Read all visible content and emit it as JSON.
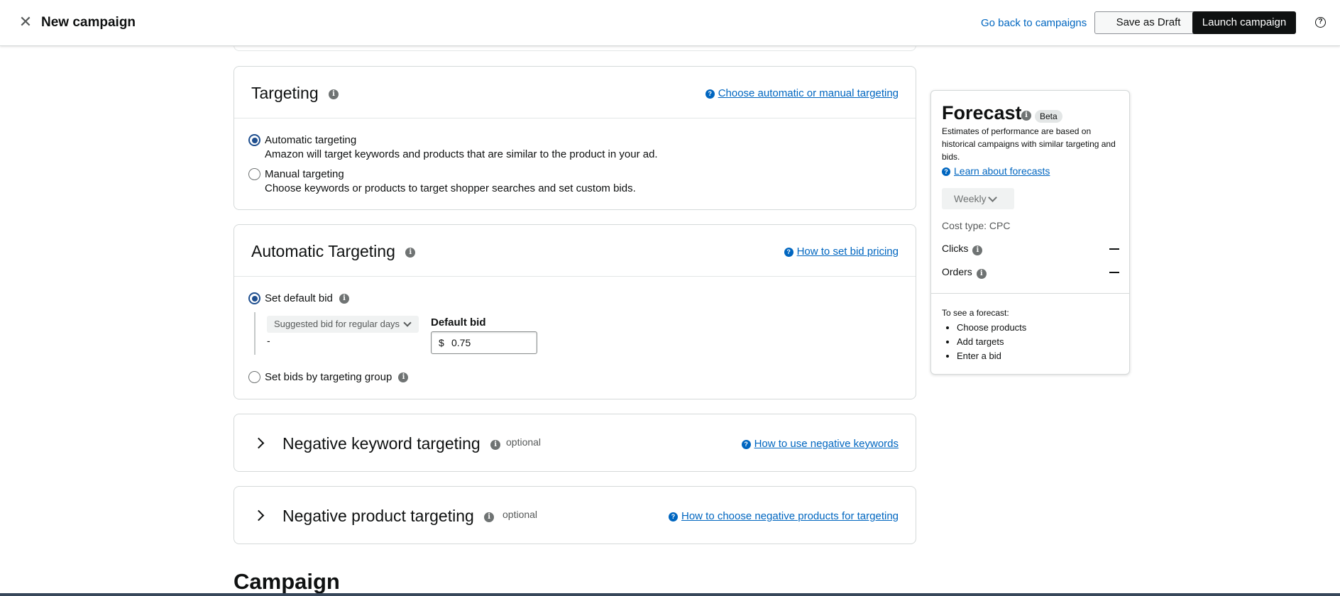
{
  "header": {
    "title": "New campaign",
    "back_link": "Go back to campaigns",
    "save_draft": "Save as Draft",
    "launch": "Launch campaign",
    "help": "?"
  },
  "targeting": {
    "title": "Targeting",
    "help_link": "Choose automatic or manual targeting",
    "options": [
      {
        "label": "Automatic targeting",
        "description": "Amazon will target keywords and products that are similar to the product in your ad.",
        "selected": true
      },
      {
        "label": "Manual targeting",
        "description": "Choose keywords or products to target shopper searches and set custom bids.",
        "selected": false
      }
    ]
  },
  "automatic_targeting": {
    "title": "Automatic Targeting",
    "help_link": "How to set bid pricing",
    "default_bid_option": "Set default bid",
    "suggested_bid_select": "Suggested bid for regular days",
    "suggested_bid_value": "-",
    "default_bid_label": "Default bid",
    "currency": "$",
    "default_bid_value": "0.75",
    "group_option": "Set bids by targeting group"
  },
  "negative_keyword": {
    "title": "Negative keyword targeting",
    "optional": "optional",
    "help_link": "How to use negative keywords"
  },
  "negative_product": {
    "title": "Negative product targeting",
    "optional": "optional",
    "help_link": "How to choose negative products for targeting"
  },
  "campaign_heading": "Campaign",
  "forecast": {
    "title": "Forecast",
    "badge": "Beta",
    "description": "Estimates of performance are based on historical campaigns with similar targeting and bids.",
    "learn_link": "Learn about forecasts",
    "period": "Weekly",
    "cost_type": "Cost type: CPC",
    "metrics": [
      {
        "label": "Clicks"
      },
      {
        "label": "Orders"
      }
    ],
    "note": "To see a forecast:",
    "steps": [
      "Choose products",
      "Add targets",
      "Enter a bid"
    ]
  },
  "icons": {
    "close": "close-icon",
    "info": "info-icon",
    "help": "help-icon",
    "chevron": "chevron-icon"
  }
}
